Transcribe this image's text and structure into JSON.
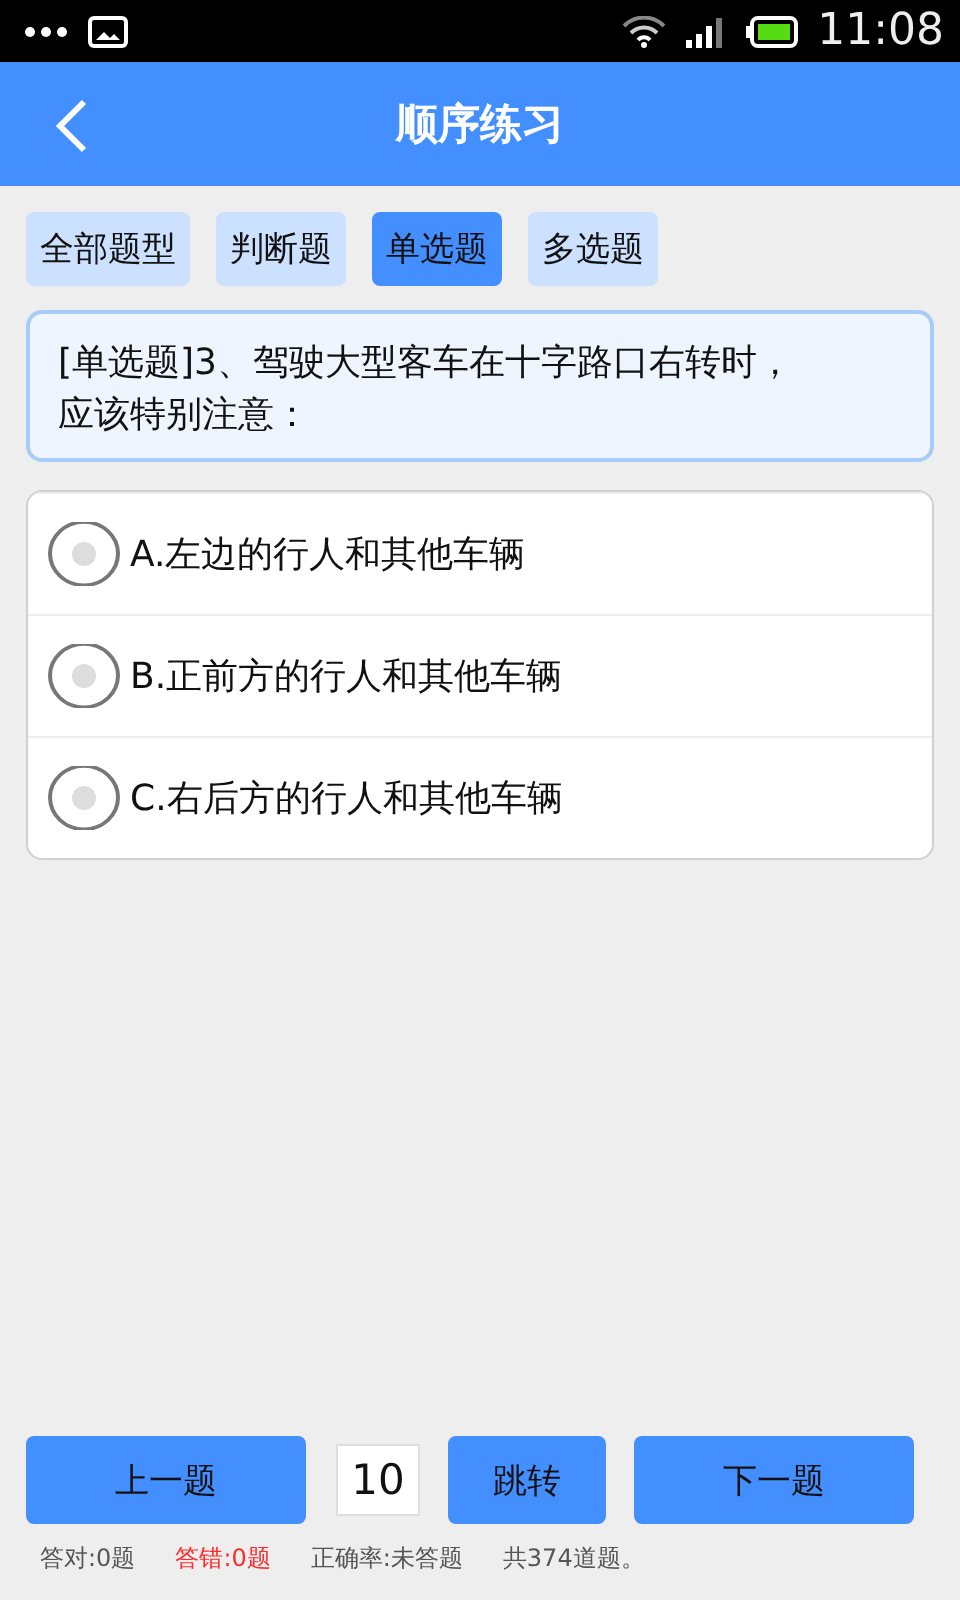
{
  "status_bar": {
    "time": "11:08"
  },
  "header": {
    "title": "顺序练习"
  },
  "tabs": [
    {
      "label": "全部题型",
      "selected": false
    },
    {
      "label": "判断题",
      "selected": false
    },
    {
      "label": "单选题",
      "selected": true
    },
    {
      "label": "多选题",
      "selected": false
    }
  ],
  "question": {
    "text": "[单选题]3、驾驶大型客车在十字路口右转时，应该特别注意："
  },
  "options": [
    {
      "label": "A.左边的行人和其他车辆",
      "selected": false
    },
    {
      "label": "B.正前方的行人和其他车辆",
      "selected": false
    },
    {
      "label": "C.右后方的行人和其他车辆",
      "selected": false
    }
  ],
  "navigation": {
    "previous": "上一题",
    "jump_value": "10",
    "jump": "跳转",
    "next": "下一题"
  },
  "stats": [
    {
      "text": "答对:0题",
      "color": "#555555"
    },
    {
      "text": "答错:0题",
      "color": "#ff2a2a"
    },
    {
      "text": "正确率:未答题",
      "color": "#555555"
    },
    {
      "text": "共374道题。",
      "color": "#555555"
    }
  ]
}
